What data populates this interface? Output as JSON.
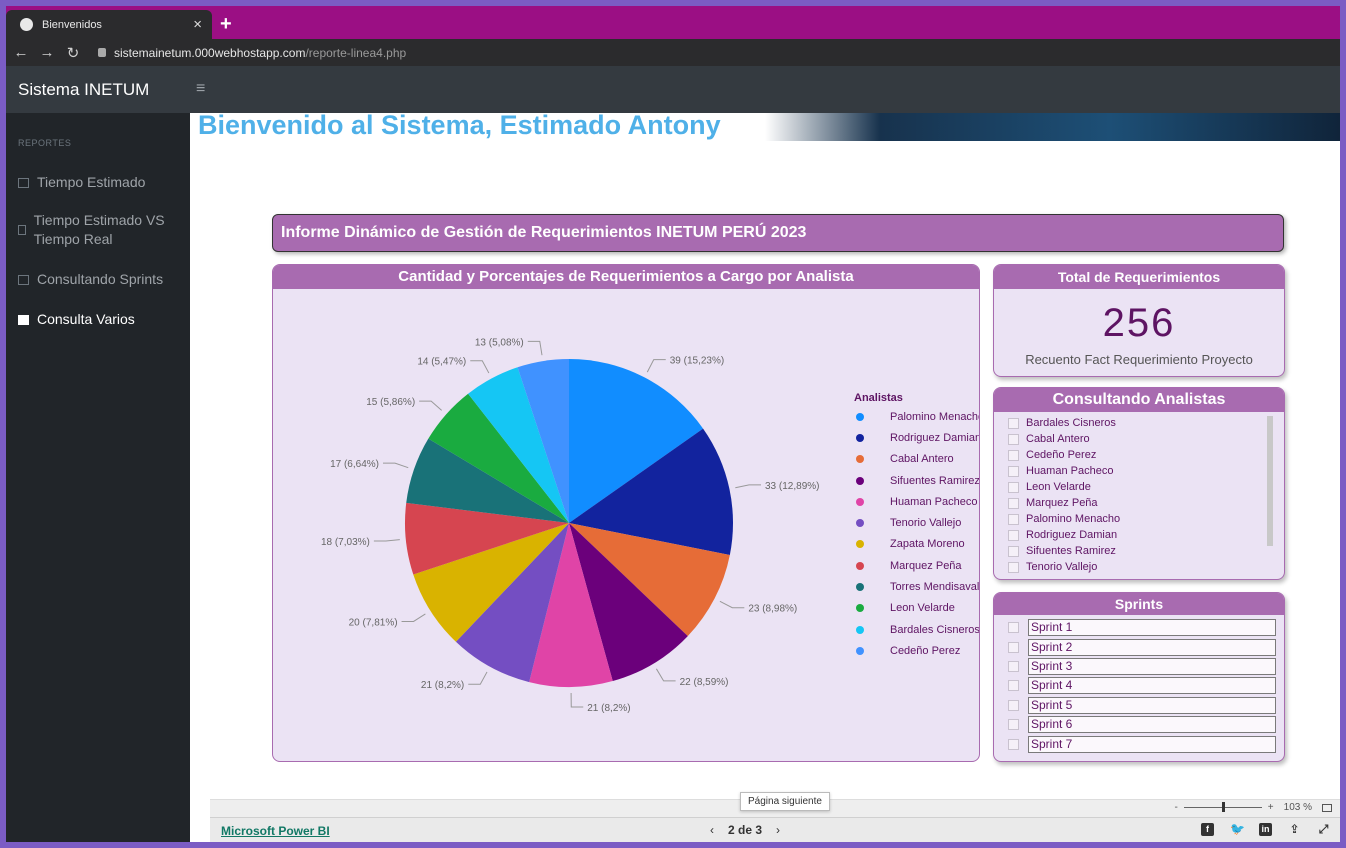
{
  "browser": {
    "tab_title": "Bienvenidos",
    "tab_close": "×",
    "new_tab": "+",
    "url_host": "sistemainetum.000webhostapp.com",
    "url_path": "/reporte-linea4.php"
  },
  "app": {
    "brand": "Sistema INETUM",
    "menu_icon": "≡"
  },
  "sidebar": {
    "heading": "REPORTES",
    "items": [
      {
        "label": "Tiempo Estimado",
        "icon": "bar-chart-icon"
      },
      {
        "label": "Tiempo Estimado VS Tiempo Real",
        "icon": "table-icon"
      },
      {
        "label": "Consultando Sprints",
        "icon": "bar-chart-icon"
      },
      {
        "label": "Consulta Varios",
        "icon": "table-icon"
      }
    ]
  },
  "banner": {
    "title": "Bienvenido al Sistema, Estimado Antony"
  },
  "report": {
    "header": "Informe Dinámico de Gestión de Requerimientos INETUM PERÚ 2023",
    "pie_title": "Cantidad y Porcentajes de Requerimientos a Cargo por Analista",
    "legend_title": "Analistas",
    "total_title": "Total de Requerimientos",
    "total_value": "256",
    "total_label": "Recuento Fact Requerimiento Proyecto",
    "analistas_title": "Consultando Analistas",
    "analistas": [
      "Bardales Cisneros",
      "Cabal Antero",
      "Cedeño Perez",
      "Huaman Pacheco",
      "Leon Velarde",
      "Marquez Peña",
      "Palomino Menacho",
      "Rodriguez Damian",
      "Sifuentes Ramirez",
      "Tenorio Vallejo"
    ],
    "sprints_title": "Sprints",
    "sprints": [
      "Sprint 1",
      "Sprint 2",
      "Sprint 3",
      "Sprint 4",
      "Sprint 5",
      "Sprint 6",
      "Sprint 7"
    ]
  },
  "chart_data": {
    "type": "pie",
    "title": "Cantidad y Porcentajes de Requerimientos a Cargo por Analista",
    "legend_title": "Analistas",
    "legend_position": "right",
    "categories": [
      "Palomino Menacho",
      "Rodriguez Damian",
      "Cabal Antero",
      "Sifuentes Ramirez",
      "Huaman Pacheco",
      "Tenorio Vallejo",
      "Zapata Moreno",
      "Marquez Peña",
      "Torres Mendisaval",
      "Leon Velarde",
      "Bardales Cisneros",
      "Cedeño Perez"
    ],
    "values": [
      39,
      33,
      23,
      22,
      21,
      21,
      20,
      18,
      17,
      15,
      14,
      13
    ],
    "labels": [
      "39 (15,23%)",
      "33 (12,89%)",
      "23 (8,98%)",
      "22 (8,59%)",
      "21 (8,2%)",
      "21 (8,2%)",
      "20 (7,81%)",
      "18 (7,03%)",
      "17 (6,64%)",
      "15 (5,86%)",
      "14 (5,47%)",
      "13 (5,08%)"
    ],
    "colors": [
      "#118DFF",
      "#12239E",
      "#E66C37",
      "#6B007B",
      "#E044A7",
      "#744EC2",
      "#D9B300",
      "#D64550",
      "#197278",
      "#1AAB40",
      "#15C6F4",
      "#4092FF"
    ]
  },
  "footer": {
    "powerbi_link": "Microsoft Power BI",
    "prev": "‹",
    "page": "2 de 3",
    "next": "›",
    "tooltip": "Página siguiente",
    "zoom_minus": "-",
    "zoom_plus": "+",
    "zoom_level": "103 %"
  }
}
